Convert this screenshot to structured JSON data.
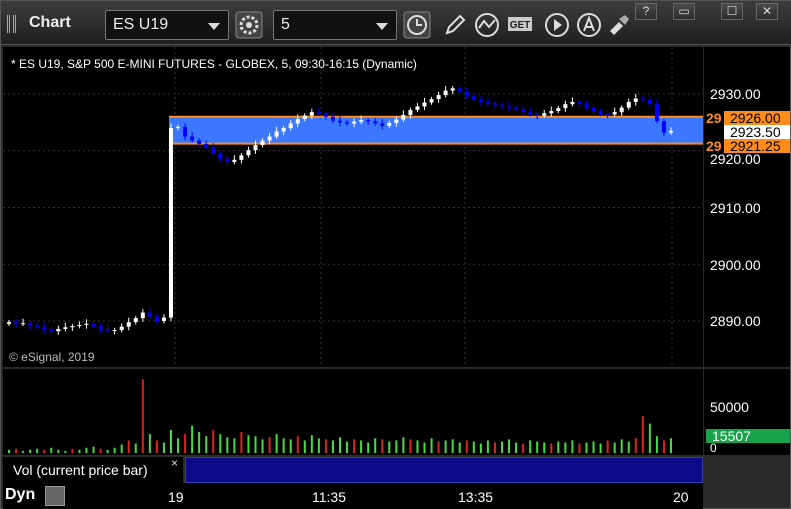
{
  "window": {
    "title": "Chart",
    "symbol": "ES U19",
    "interval": "5",
    "buttons": {
      "help": "?",
      "restore": "▭",
      "maximize": "☐",
      "close": "✕"
    }
  },
  "chart": {
    "header": "* ES U19, S&P 500 E-MINI FUTURES - GLOBEX, 5, 09:30-16:15 (Dynamic)",
    "copyright": "© eSignal, 2019",
    "price_ticks": [
      "2930.00",
      "2920.00",
      "2910.00",
      "2900.00",
      "2890.00"
    ],
    "tags": {
      "zone_top": "2926.00",
      "zone_bottom": "2921.25",
      "last": "2923.50",
      "zone_top_short": "29",
      "zone_bottom_short": "29"
    },
    "volume": {
      "tick": "50000",
      "zero": "0",
      "last_label": "15507",
      "legend": "Vol (current price bar)",
      "close": "×"
    },
    "time_ticks": [
      "19",
      "11:35",
      "13:35",
      "20"
    ],
    "dyn_label": "Dyn",
    "colors": {
      "up_candle": "#ffffff",
      "down_candle": "#0000ff",
      "zone_fill": "#3b78ff",
      "zone_border": "#ff8c1a",
      "vol_up": "#44dd44",
      "vol_down": "#dd2222"
    }
  },
  "icons": [
    "bars-icon",
    "gear-icon",
    "clock-icon",
    "pencil-icon",
    "chart-line-icon",
    "get-icon",
    "play-icon",
    "alert-icon",
    "tools-icon"
  ]
}
